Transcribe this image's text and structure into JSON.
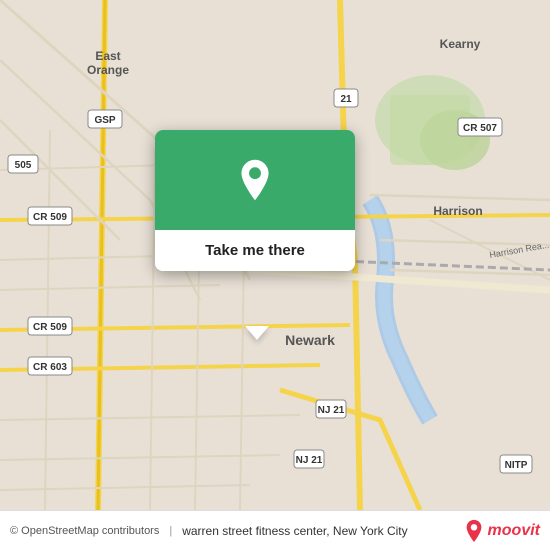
{
  "map": {
    "background_color": "#e8e0d8",
    "attribution": "© OpenStreetMap contributors"
  },
  "popup": {
    "button_label": "Take me there",
    "pin_icon": "location-pin"
  },
  "bottom_bar": {
    "copyright": "© OpenStreetMap contributors",
    "location_text": "warren street fitness center, New York City",
    "brand": "moovit"
  }
}
